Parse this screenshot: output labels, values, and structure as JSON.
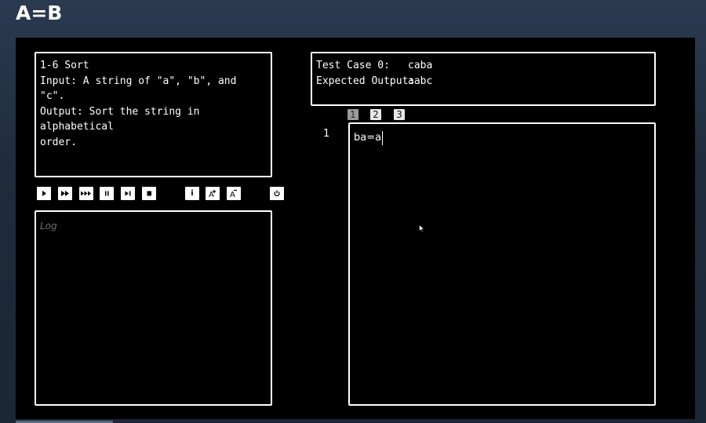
{
  "window": {
    "title": "A=B"
  },
  "puzzle": {
    "text": "1-6 Sort\nInput: A string of \"a\", \"b\", and \"c\".\nOutput: Sort the string in alphabetical\norder."
  },
  "test_case": {
    "label": "Test Case 0:",
    "value": "caba",
    "expected_label": "Expected Output:",
    "expected_value": "aabc"
  },
  "controls": [
    {
      "name": "run-icon",
      "glyph": "play"
    },
    {
      "name": "fast-forward-icon",
      "glyph": "ff"
    },
    {
      "name": "fastest-forward-icon",
      "glyph": "fff"
    },
    {
      "name": "pause-icon",
      "glyph": "pause"
    },
    {
      "name": "step-icon",
      "glyph": "step"
    },
    {
      "name": "stop-icon",
      "glyph": "stop"
    },
    {
      "name": "info-icon",
      "glyph": "i"
    },
    {
      "name": "font-increase-icon",
      "glyph": "A+"
    },
    {
      "name": "font-decrease-icon",
      "glyph": "A-"
    },
    {
      "name": "power-icon",
      "glyph": "power"
    }
  ],
  "tabs": [
    {
      "label": "1",
      "active": true
    },
    {
      "label": "2",
      "active": false
    },
    {
      "label": "3",
      "active": false
    }
  ],
  "log": {
    "placeholder": "Log"
  },
  "editor": {
    "line_numbers": [
      "1"
    ],
    "lines": [
      "ba=a"
    ]
  },
  "colors": {
    "background": "#1f2c3d",
    "panel": "#000000",
    "border": "#ffffff",
    "active_tab": "#9a9a9a"
  }
}
